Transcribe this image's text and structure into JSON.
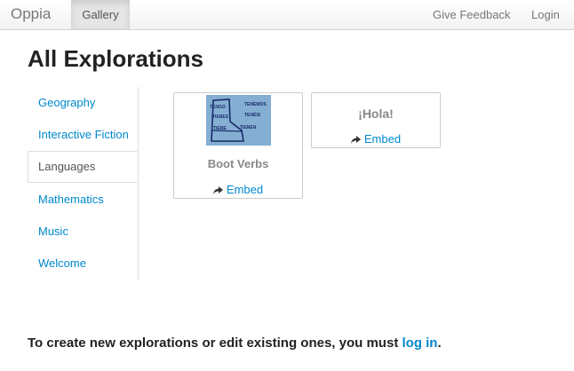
{
  "navbar": {
    "brand": "Oppia",
    "gallery": "Gallery",
    "feedback": "Give Feedback",
    "login": "Login"
  },
  "page_title": "All Explorations",
  "categories": [
    "Geography",
    "Interactive Fiction",
    "Languages",
    "Mathematics",
    "Music",
    "Welcome"
  ],
  "active_category": "Languages",
  "explorations": [
    {
      "title": "Boot Verbs",
      "embed": "Embed",
      "thumbnail_words": [
        "TENGO",
        "TENEMOS",
        "TIENES",
        "TENÉIS",
        "TIENE",
        "TIENEN"
      ]
    },
    {
      "title": "¡Hola!",
      "embed": "Embed"
    }
  ],
  "footer": {
    "message": "To create new explorations or edit existing ones, you must ",
    "link": "log in",
    "end": "."
  },
  "colors": {
    "link": "#0088cc",
    "heading": "#222222",
    "muted": "#888888"
  }
}
